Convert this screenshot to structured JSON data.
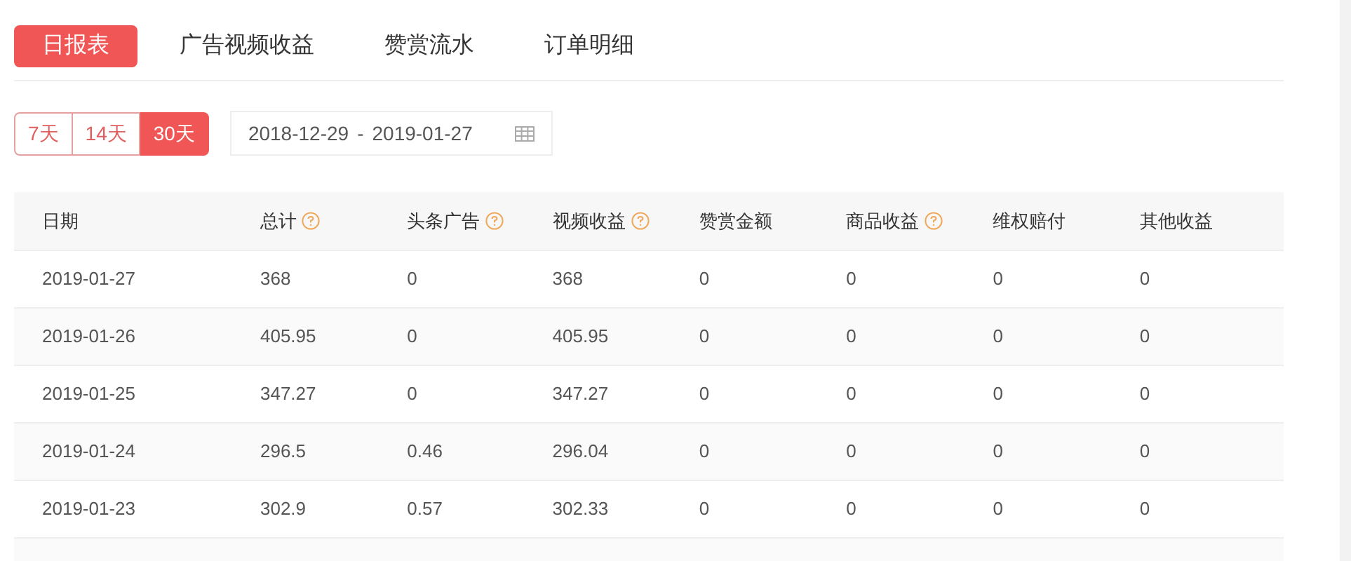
{
  "tabs": [
    {
      "label": "日报表",
      "selected": true
    },
    {
      "label": "广告视频收益",
      "selected": false
    },
    {
      "label": "赞赏流水",
      "selected": false
    },
    {
      "label": "订单明细",
      "selected": false
    }
  ],
  "ranges": [
    {
      "label": "7天",
      "selected": false
    },
    {
      "label": "14天",
      "selected": false
    },
    {
      "label": "30天",
      "selected": true
    }
  ],
  "date_range": {
    "start": "2018-12-29",
    "separator": "-",
    "end": "2019-01-27"
  },
  "table": {
    "columns": [
      {
        "label": "日期",
        "help": false
      },
      {
        "label": "总计",
        "help": true
      },
      {
        "label": "头条广告",
        "help": true
      },
      {
        "label": "视频收益",
        "help": true
      },
      {
        "label": "赞赏金额",
        "help": false
      },
      {
        "label": "商品收益",
        "help": true
      },
      {
        "label": "维权赔付",
        "help": false
      },
      {
        "label": "其他收益",
        "help": false
      }
    ],
    "rows": [
      [
        "2019-01-27",
        "368",
        "0",
        "368",
        "0",
        "0",
        "0",
        "0"
      ],
      [
        "2019-01-26",
        "405.95",
        "0",
        "405.95",
        "0",
        "0",
        "0",
        "0"
      ],
      [
        "2019-01-25",
        "347.27",
        "0",
        "347.27",
        "0",
        "0",
        "0",
        "0"
      ],
      [
        "2019-01-24",
        "296.5",
        "0.46",
        "296.04",
        "0",
        "0",
        "0",
        "0"
      ],
      [
        "2019-01-23",
        "302.9",
        "0.57",
        "302.33",
        "0",
        "0",
        "0",
        "0"
      ]
    ]
  }
}
